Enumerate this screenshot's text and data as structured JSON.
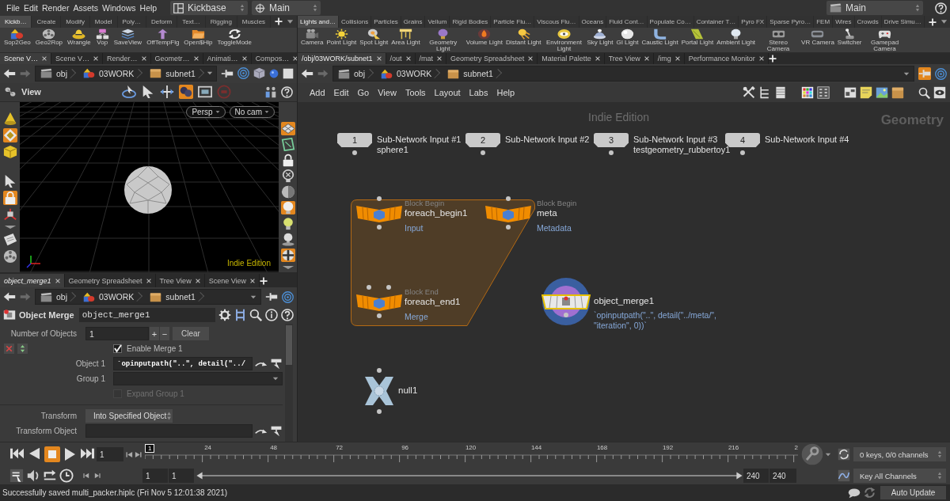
{
  "menu_bar": {
    "menus": [
      "File",
      "Edit",
      "Render",
      "Assets",
      "Windows",
      "Help"
    ],
    "selectors": [
      "Kickbase",
      "Main",
      "Main"
    ]
  },
  "shelves": [
    {
      "tabs": [
        {
          "label": "Kickb…",
          "selected": true
        },
        {
          "label": "Create",
          "selected": false
        },
        {
          "label": "Modify",
          "selected": false
        },
        {
          "label": "Model",
          "selected": false
        },
        {
          "label": "Poly…",
          "selected": false
        },
        {
          "label": "Deform",
          "selected": false
        },
        {
          "label": "Text…",
          "selected": false
        },
        {
          "label": "Rigging",
          "selected": false
        },
        {
          "label": "Muscles",
          "selected": false
        }
      ],
      "tools": [
        "Sop2Geo",
        "Geo2Rop",
        "Wrangle",
        "Vop",
        "SaveView",
        "OffTempFlg",
        "Open$Hip",
        "ToggleMode"
      ]
    },
    {
      "tabs": [
        {
          "label": "Lights and…",
          "selected": true
        },
        {
          "label": "Collisions",
          "selected": false
        },
        {
          "label": "Particles",
          "selected": false
        },
        {
          "label": "Grains",
          "selected": false
        },
        {
          "label": "Vellum",
          "selected": false
        },
        {
          "label": "Rigid Bodies",
          "selected": false
        },
        {
          "label": "Particle Flu…",
          "selected": false
        },
        {
          "label": "Viscous Flu…",
          "selected": false
        },
        {
          "label": "Oceans",
          "selected": false
        },
        {
          "label": "Fluid Cont…",
          "selected": false
        },
        {
          "label": "Populate Co…",
          "selected": false
        },
        {
          "label": "Container T…",
          "selected": false
        },
        {
          "label": "Pyro FX",
          "selected": false
        },
        {
          "label": "Sparse Pyro…",
          "selected": false
        },
        {
          "label": "FEM",
          "selected": false
        },
        {
          "label": "Wires",
          "selected": false
        },
        {
          "label": "Crowds",
          "selected": false
        },
        {
          "label": "Drive Simu…",
          "selected": false
        }
      ],
      "tools": [
        "Camera",
        "Point Light",
        "Spot Light",
        "Area Light",
        "Geometry Light",
        "Volume Light",
        "Distant Light",
        "Environment Light",
        "Sky Light",
        "GI Light",
        "Caustic Light",
        "Portal Light",
        "Ambient Light",
        "Stereo Camera",
        "VR Camera",
        "Switcher",
        "Gamepad Camera"
      ]
    }
  ],
  "scene_pane": {
    "tabs": [
      {
        "label": "Scene V…",
        "selected": true
      },
      {
        "label": "Scene V…",
        "selected": false
      },
      {
        "label": "Render…",
        "selected": false
      },
      {
        "label": "Geometr…",
        "selected": false
      },
      {
        "label": "Animati…",
        "selected": false
      },
      {
        "label": "Compos…",
        "selected": false
      }
    ],
    "path": [
      "obj",
      "03WORK",
      "subnet1"
    ],
    "pinned": false,
    "view_label": "View",
    "view_tools": [
      {
        "on": false
      },
      {
        "on": false
      },
      {
        "on": false
      },
      {
        "on": true
      },
      {
        "on": false
      },
      {
        "on": false
      }
    ],
    "camera_menus": [
      "Persp",
      "No cam"
    ],
    "edition_label": "Indie Edition",
    "left_tools": [
      {
        "on": false
      },
      {
        "on": true
      },
      {
        "on": false
      },
      {
        "on": false
      },
      {
        "on": true
      },
      {
        "on": false
      },
      {
        "on": false
      },
      {
        "on": false
      },
      {
        "on": false
      }
    ],
    "right_tools": [
      {
        "on": true
      },
      {
        "on": false
      },
      {
        "on": false
      },
      {
        "on": false
      },
      {
        "on": false
      },
      {
        "on": true
      },
      {
        "on": false
      },
      {
        "on": false
      },
      {
        "on": true
      },
      {
        "on": false
      }
    ]
  },
  "parameter_pane": {
    "tabs": [
      {
        "label": "object_merge1",
        "selected": true,
        "follows_selection": true
      },
      {
        "label": "Geometry Spreadsheet",
        "selected": false,
        "follows_selection": false
      },
      {
        "label": "Tree View",
        "selected": false,
        "follows_selection": false
      },
      {
        "label": "Scene View",
        "selected": false,
        "follows_selection": false
      }
    ],
    "path": [
      "obj",
      "03WORK",
      "subnet1"
    ],
    "pinned": false,
    "node_type": "Object Merge",
    "node_name": "object_merge1",
    "params": [
      {
        "kind": "count",
        "label": "Number of Objects",
        "value": "1",
        "buttons": [
          "+",
          "−"
        ],
        "action": "Clear"
      },
      {
        "kind": "multiparm",
        "params": [
          {
            "kind": "toggle",
            "label": "Enable Merge 1",
            "checked": true,
            "disabled": false
          },
          {
            "kind": "text",
            "label": "Object 1",
            "value": "`opinputpath(\"..\", detail(\"../"
          },
          {
            "kind": "text_menu",
            "label": "Group 1"
          },
          {
            "kind": "toggle",
            "label": "Expand Group 1",
            "checked": false,
            "disabled": true
          }
        ]
      },
      {
        "kind": "menu",
        "label": "Transform",
        "value": "Into Specified Object"
      },
      {
        "kind": "text",
        "label": "Transform Object"
      }
    ]
  },
  "network_pane": {
    "tabs": [
      {
        "label": "/obj/03WORK/subnet1",
        "selected": true
      },
      {
        "label": "/out",
        "selected": false
      },
      {
        "label": "/mat",
        "selected": false
      },
      {
        "label": "Geometry Spreadsheet",
        "selected": false
      },
      {
        "label": "Material Palette",
        "selected": false
      },
      {
        "label": "Tree View",
        "selected": false
      },
      {
        "label": "/img",
        "selected": false
      },
      {
        "label": "Performance Monitor",
        "selected": false
      }
    ],
    "path": [
      "obj",
      "03WORK",
      "subnet1"
    ],
    "pinned": true,
    "menus": [
      "Add",
      "Edit",
      "Go",
      "View",
      "Tools",
      "Layout",
      "Labs",
      "Help"
    ],
    "edition_label": "Indie Edition",
    "context_label": "Geometry",
    "subnet_inputs": [
      {
        "number": "1",
        "label": "Sub-Network Input #1",
        "source": "sphere1"
      },
      {
        "number": "2",
        "label": "Sub-Network Input #2"
      },
      {
        "number": "3",
        "label": "Sub-Network Input #3",
        "source": "testgeometry_rubbertoy1"
      },
      {
        "number": "4",
        "label": "Sub-Network Input #4"
      }
    ],
    "block_nodes": [
      {
        "kind": "begin",
        "type": "Block Begin",
        "name": "foreach_begin1",
        "comment": "Input"
      },
      {
        "kind": "begin",
        "type": "Block Begin",
        "name": "meta",
        "comment": "Metadata"
      },
      {
        "kind": "end",
        "type": "Block End",
        "name": "foreach_end1",
        "comment": "Merge"
      }
    ],
    "merge_node": {
      "name": "object_merge1",
      "expression": "`opinputpath(\"..\", detail(\"../meta/\", \"iteration\", 0))`"
    },
    "null_node": {
      "name": "null1"
    }
  },
  "timeline": {
    "playing": false,
    "frame": "1",
    "marker": "1",
    "ticks": [
      "24",
      "48",
      "72",
      "96",
      "120",
      "144",
      "168",
      "192",
      "216",
      "2"
    ],
    "range": [
      "1",
      "1",
      "240",
      "240"
    ],
    "range_bar": {
      "level": 1
    },
    "keys_status": "0 keys, 0/0 channels",
    "key_mode": "Key All Channels"
  },
  "status_bar": {
    "message": "Successfully saved multi_packer.hiplc (Fri Nov 5 12:01:38 2021)",
    "update_mode": "Auto Update"
  }
}
